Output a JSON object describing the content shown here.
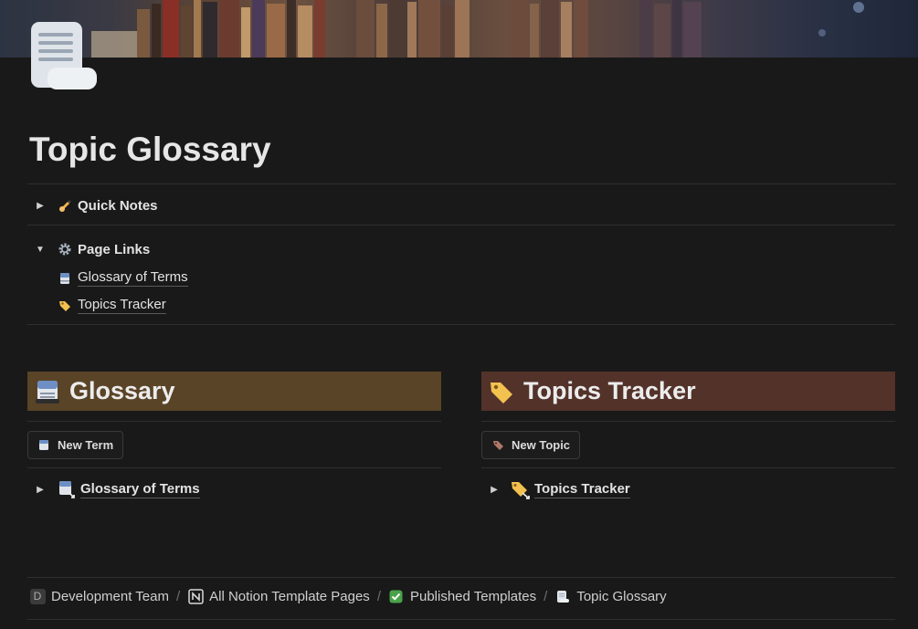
{
  "page": {
    "title": "Topic Glossary",
    "icon": "scroll-icon"
  },
  "quick_notes": {
    "label": "Quick Notes",
    "icon": "writing-hand-icon",
    "expanded": false
  },
  "page_links": {
    "label": "Page Links",
    "icon": "gear-icon",
    "expanded": true,
    "items": [
      {
        "label": "Glossary of Terms",
        "icon": "card-index-icon"
      },
      {
        "label": "Topics Tracker",
        "icon": "label-tag-icon"
      }
    ]
  },
  "glossary": {
    "heading": "Glossary",
    "icon": "card-index-icon",
    "color": "#5a4427",
    "button_label": "New Term",
    "database_label": "Glossary of Terms"
  },
  "topics": {
    "heading": "Topics Tracker",
    "icon": "label-tag-icon",
    "color": "#53322a",
    "button_label": "New Topic",
    "database_label": "Topics Tracker"
  },
  "breadcrumb": [
    {
      "label": "Development Team",
      "icon": "workspace-d-icon"
    },
    {
      "label": "All Notion Template Pages",
      "icon": "notion-logo-icon"
    },
    {
      "label": "Published Templates",
      "icon": "checkmark-box-icon"
    },
    {
      "label": "Topic Glossary",
      "icon": "scroll-icon"
    }
  ],
  "workspace_initial": "D"
}
